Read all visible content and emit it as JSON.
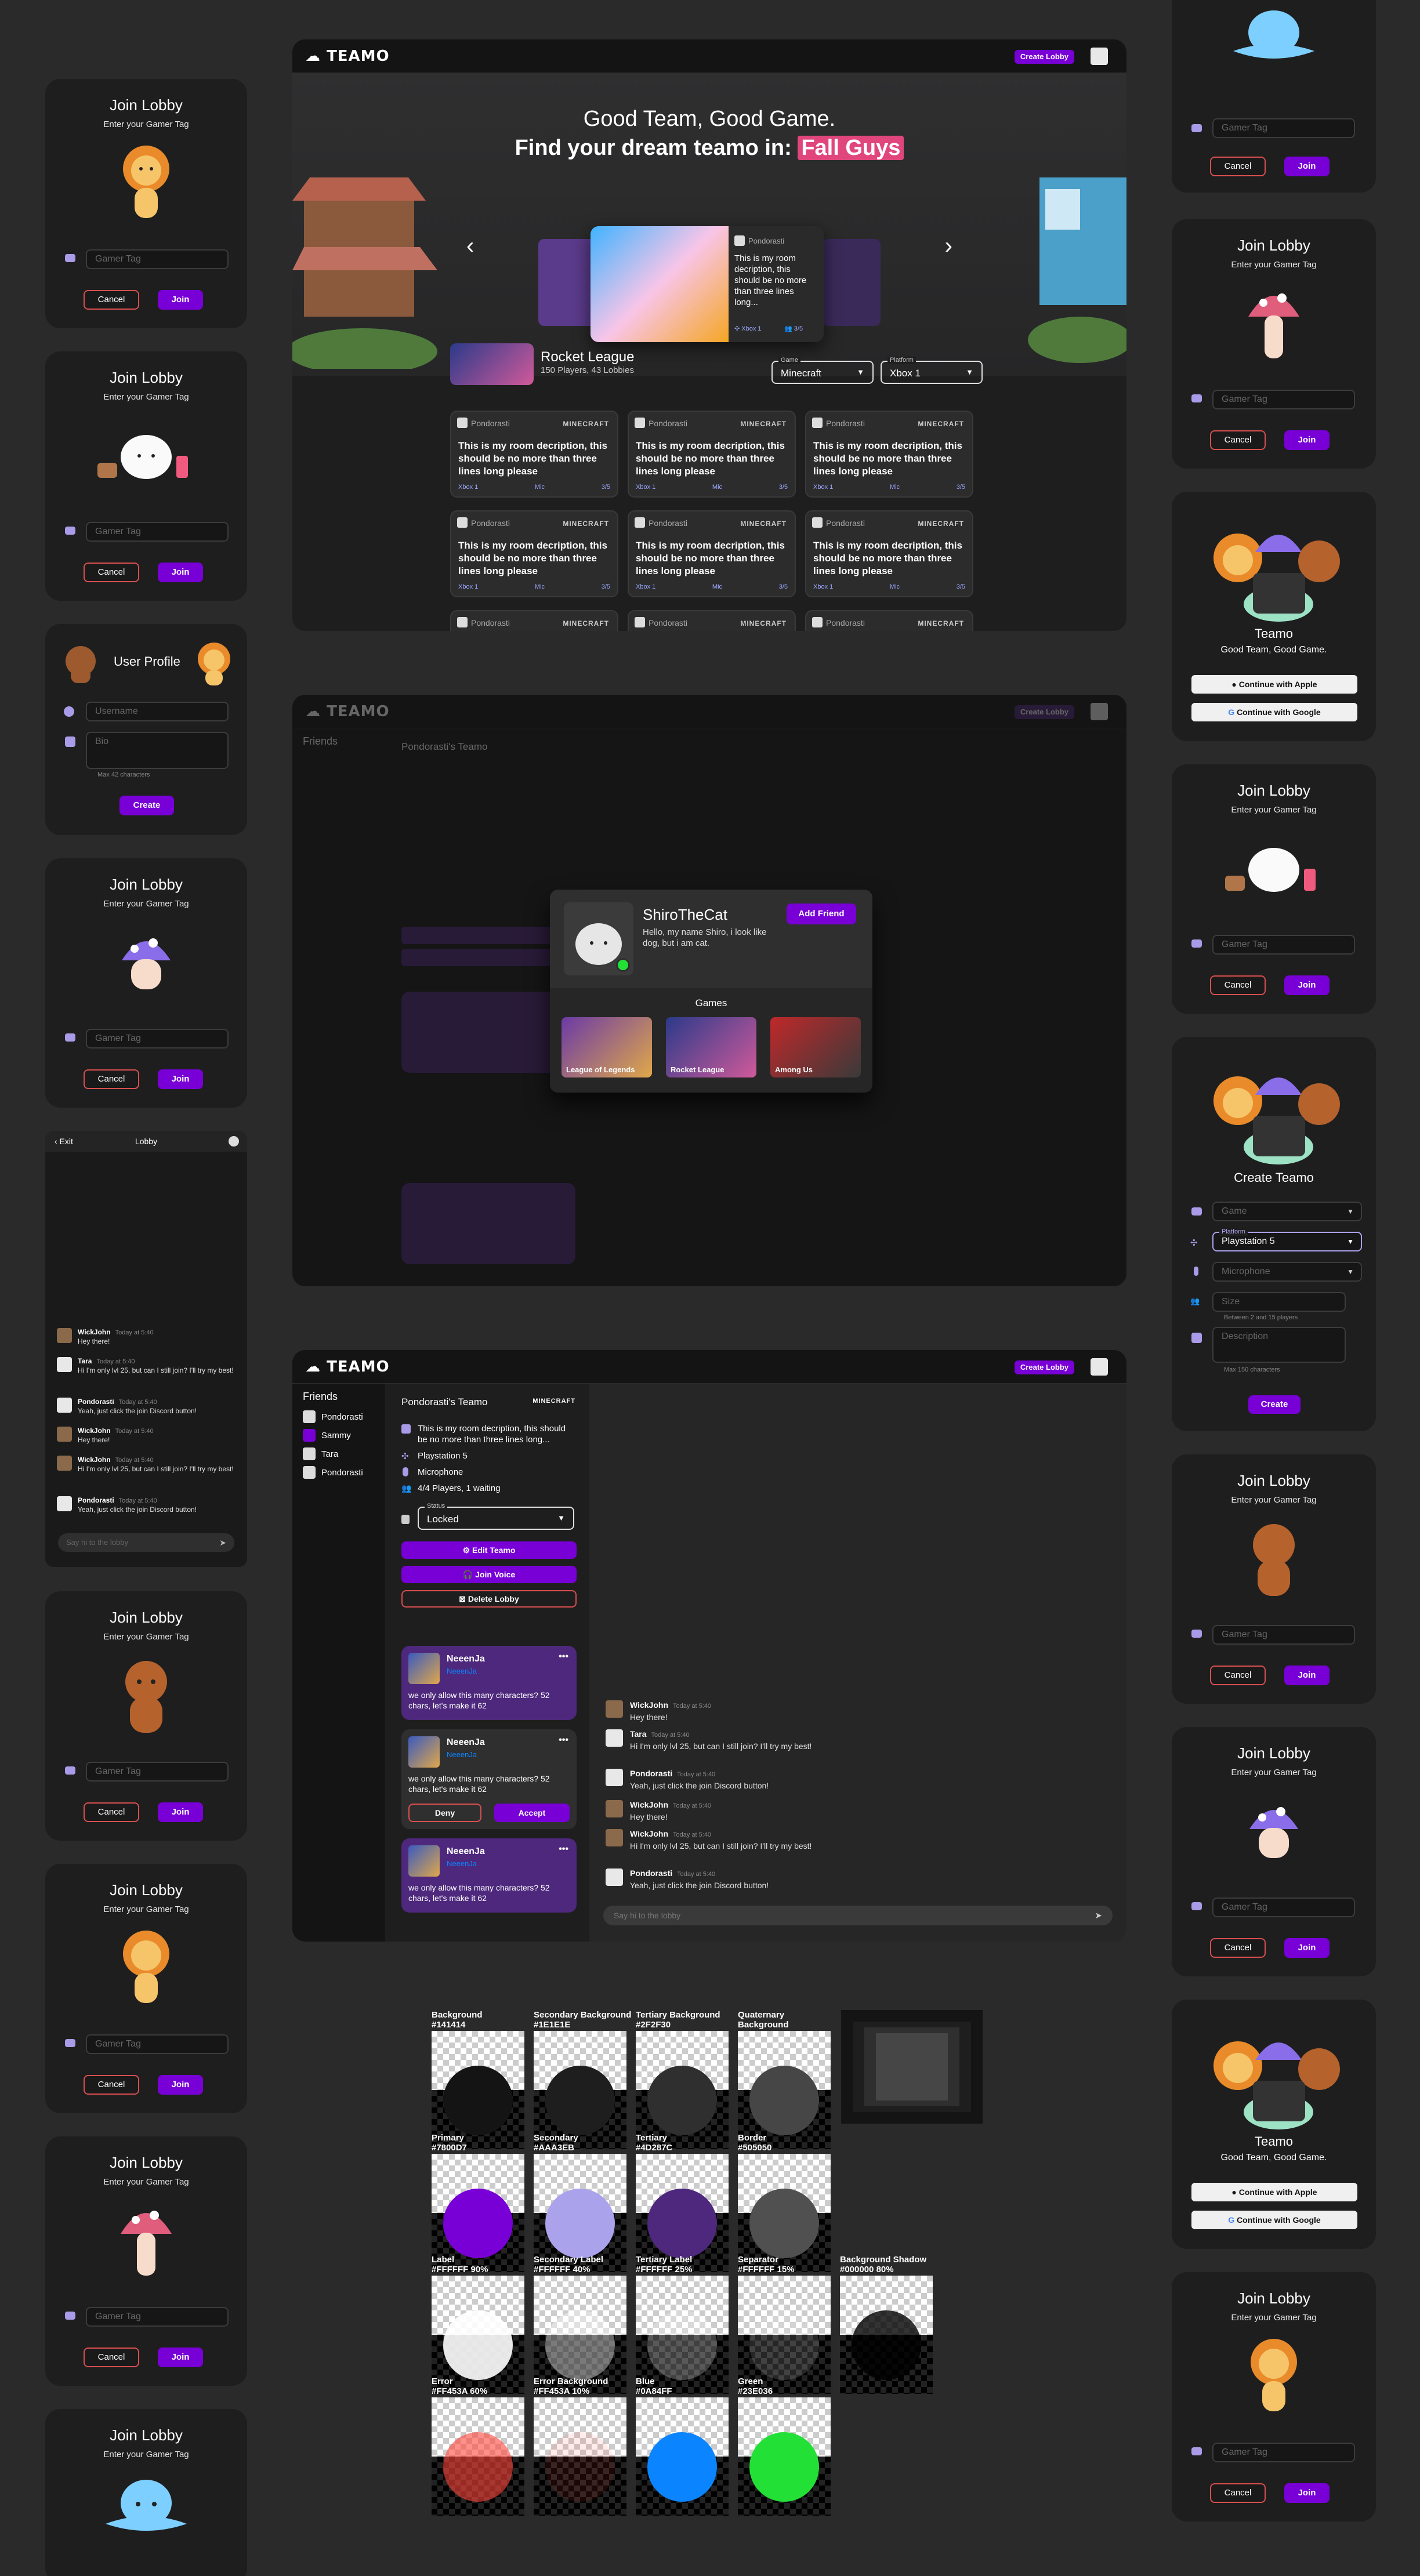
{
  "app": {
    "name": "TEAMO",
    "create_lobby": "Create Lobby"
  },
  "join_lobby": {
    "title": "Join Lobby",
    "subtitle": "Enter your Gamer Tag",
    "placeholder": "Gamer Tag",
    "cancel": "Cancel",
    "join": "Join"
  },
  "user_profile": {
    "title": "User Profile",
    "username_placeholder": "Username",
    "bio_placeholder": "Bio",
    "hint": "Max 42 characters",
    "create": "Create"
  },
  "mobile_lobby": {
    "exit": "‹ Exit",
    "title": "Lobby",
    "input_placeholder": "Say hi to the lobby",
    "messages": [
      {
        "name": "WickJohn",
        "time": "Today at 5:40",
        "text": "Hey there!"
      },
      {
        "name": "Tara",
        "time": "Today at 5:40",
        "text": "Hi I'm only lvl 25, but can I still join? I'll try my best!"
      },
      {
        "name": "Pondorasti",
        "time": "Today at 5:40",
        "text": "Yeah, just click the join Discord button!"
      },
      {
        "name": "WickJohn",
        "time": "Today at 5:40",
        "text": "Hey there!"
      },
      {
        "name": "WickJohn",
        "time": "Today at 5:40",
        "text": "Hi I'm only lvl 25, but can I still join? I'll try my best!"
      },
      {
        "name": "Pondorasti",
        "time": "Today at 5:40",
        "text": "Yeah, just click the join Discord button!"
      }
    ]
  },
  "hero": {
    "line1": "Good Team, Good Game.",
    "line2": "Find your dream teamo in:",
    "highlight": "Fall Guys",
    "featured": {
      "user": "Pondorasti",
      "desc": "This is my room decription, this should be no more than three lines long...",
      "platform": "Xbox 1",
      "size": "3/5"
    }
  },
  "browse": {
    "game_name": "Rocket League",
    "game_stats": "150 Players,  43 Lobbies",
    "game_label": "Game",
    "game_value": "Minecraft",
    "platform_label": "Platform",
    "platform_value": "Xbox 1"
  },
  "room_card": {
    "user": "Pondorasti",
    "game_logo": "MINECRAFT",
    "desc": "This is my room decription, this should be no more than three lines long please",
    "platform": "Xbox 1",
    "mic": "Mic",
    "size": "3/5"
  },
  "lobby": {
    "friends_title": "Friends",
    "friends": [
      "Pondorasti",
      "Sammy",
      "Tara",
      "Pondorasti"
    ],
    "teamo_title": "Pondorasti's Teamo",
    "game_logo": "MINECRAFT",
    "description": "This is my room decription, this should be no more than three lines long...",
    "platform": "Playstation 5",
    "mic": "Microphone",
    "players": "4/4 Players, 1 waiting",
    "status_label": "Status",
    "status_value": "Locked",
    "edit": "Edit Teamo",
    "voice": "Join Voice",
    "delete": "Delete Lobby",
    "members": [
      {
        "name": "NeeenJa",
        "tag": "NeeenJa",
        "text": "we only allow this many characters? 52 chars, let's make it 62"
      },
      {
        "name": "NeeenJa",
        "tag": "NeeenJa",
        "text": "we only allow this many characters? 52 chars, let's make it 62",
        "deny": "Deny",
        "accept": "Accept"
      },
      {
        "name": "NeeenJa",
        "tag": "NeeenJa",
        "text": "we only allow this many characters? 52 chars, let's make it 62"
      }
    ],
    "input_placeholder": "Say hi to the lobby"
  },
  "profile_modal": {
    "name": "ShiroTheCat",
    "bio": "Hello, my name Shiro, i look like dog, but i am cat.",
    "add_friend": "Add Friend",
    "games_title": "Games",
    "games": [
      "League of Legends",
      "Rocket League",
      "Among Us"
    ]
  },
  "auth": {
    "title": "Teamo",
    "subtitle": "Good Team, Good Game.",
    "apple": "Continue with Apple",
    "google": "Continue with Google"
  },
  "create_teamo": {
    "title": "Create Teamo",
    "game_placeholder": "Game",
    "platform_label": "Platform",
    "platform_value": "Playstation 5",
    "mic_placeholder": "Microphone",
    "size_placeholder": "Size",
    "size_hint": "Between 2 and 15 players",
    "desc_placeholder": "Description",
    "desc_hint": "Max 150 characters",
    "create": "Create"
  },
  "palette": [
    {
      "name": "Background",
      "value": "#141414",
      "color": "#141414"
    },
    {
      "name": "Secondary Background",
      "value": "#1E1E1E",
      "color": "#1e1e1e"
    },
    {
      "name": "Tertiary Background",
      "value": "#2F2F30",
      "color": "#2f2f30"
    },
    {
      "name": "Quaternary Background",
      "value": "#464646",
      "color": "#464646"
    },
    {
      "name": "Primary",
      "value": "#7800D7",
      "color": "#7800d7"
    },
    {
      "name": "Secondary",
      "value": "#AAA3EB",
      "color": "#aaa3eb"
    },
    {
      "name": "Tertiary",
      "value": "#4D287C",
      "color": "#4d287c"
    },
    {
      "name": "Border",
      "value": "#505050",
      "color": "#505050"
    },
    {
      "name": "Label",
      "value": "#FFFFFF 90%",
      "color": "rgba(255,255,255,0.9)"
    },
    {
      "name": "Secondary Label",
      "value": "#FFFFFF 40%",
      "color": "rgba(255,255,255,0.4)"
    },
    {
      "name": "Tertiary Label",
      "value": "#FFFFFF 25%",
      "color": "rgba(255,255,255,0.25)"
    },
    {
      "name": "Separator",
      "value": "#FFFFFF 15%",
      "color": "rgba(255,255,255,0.15)"
    },
    {
      "name": "Background Shadow",
      "value": "#000000 80%",
      "color": "rgba(0,0,0,0.8)"
    },
    {
      "name": "Error",
      "value": "#FF453A 60%",
      "color": "rgba(255,69,58,0.6)"
    },
    {
      "name": "Error Background",
      "value": "#FF453A 10%",
      "color": "rgba(255,69,58,0.1)"
    },
    {
      "name": "Blue",
      "value": "#0A84FF",
      "color": "#0a84ff"
    },
    {
      "name": "Green",
      "value": "#23E036",
      "color": "#23e036"
    }
  ]
}
